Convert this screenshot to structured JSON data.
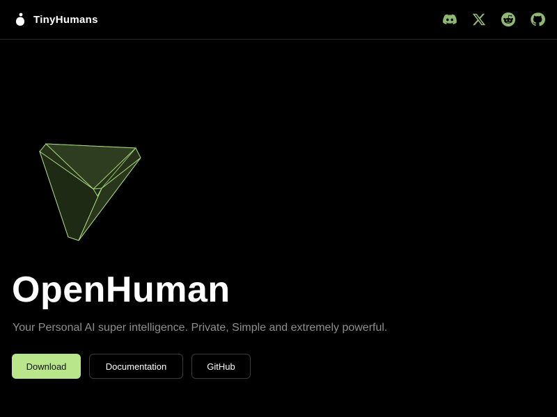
{
  "header": {
    "brand_name": "TinyHumans",
    "socials": [
      {
        "icon": "discord-icon"
      },
      {
        "icon": "x-icon"
      },
      {
        "icon": "reddit-icon"
      },
      {
        "icon": "github-icon"
      }
    ]
  },
  "hero": {
    "title": "OpenHuman",
    "subtitle": "Your Personal AI super intelligence. Private, Simple and extremely powerful.",
    "buttons": {
      "download": "Download",
      "documentation": "Documentation",
      "github": "GitHub"
    }
  },
  "colors": {
    "background": "#000000",
    "accent": "#b9e68b",
    "icon": "#8fb873",
    "muted_text": "#8e8e8e",
    "shape_fill": "#2b3a1f",
    "shape_stroke": "#a8d97e"
  }
}
